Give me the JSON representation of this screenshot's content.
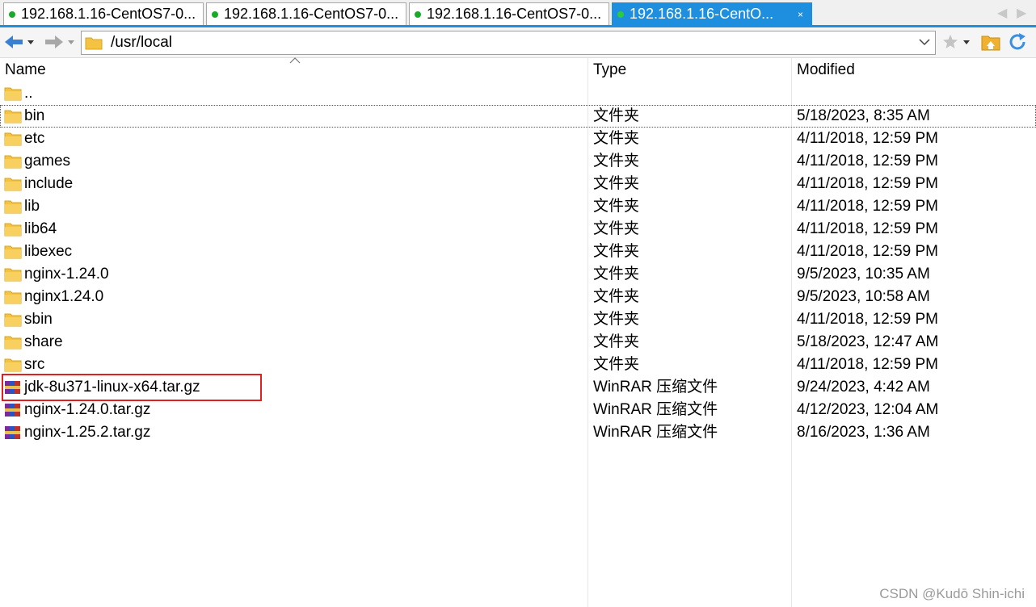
{
  "tabs": [
    {
      "label": "192.168.1.16-CentOS7-0..."
    },
    {
      "label": "192.168.1.16-CentOS7-0..."
    },
    {
      "label": "192.168.1.16-CentOS7-0..."
    },
    {
      "label": "192.168.1.16-CentO...",
      "active": true,
      "close": "×"
    }
  ],
  "toolbar": {
    "path": "/usr/local"
  },
  "columns": {
    "name": "Name",
    "type": "Type",
    "modified": "Modified"
  },
  "files": [
    {
      "name": "..",
      "type": "",
      "modified": "",
      "icon": "folder-icon"
    },
    {
      "name": "bin",
      "type": "文件夹",
      "modified": "5/18/2023, 8:35 AM",
      "icon": "folder-icon"
    },
    {
      "name": "etc",
      "type": "文件夹",
      "modified": "4/11/2018, 12:59 PM",
      "icon": "folder-icon"
    },
    {
      "name": "games",
      "type": "文件夹",
      "modified": "4/11/2018, 12:59 PM",
      "icon": "folder-icon"
    },
    {
      "name": "include",
      "type": "文件夹",
      "modified": "4/11/2018, 12:59 PM",
      "icon": "folder-icon"
    },
    {
      "name": "lib",
      "type": "文件夹",
      "modified": "4/11/2018, 12:59 PM",
      "icon": "folder-icon"
    },
    {
      "name": "lib64",
      "type": "文件夹",
      "modified": "4/11/2018, 12:59 PM",
      "icon": "folder-icon"
    },
    {
      "name": "libexec",
      "type": "文件夹",
      "modified": "4/11/2018, 12:59 PM",
      "icon": "folder-icon"
    },
    {
      "name": "nginx-1.24.0",
      "type": "文件夹",
      "modified": "9/5/2023, 10:35 AM",
      "icon": "folder-icon"
    },
    {
      "name": "nginx1.24.0",
      "type": "文件夹",
      "modified": "9/5/2023, 10:58 AM",
      "icon": "folder-icon"
    },
    {
      "name": "sbin",
      "type": "文件夹",
      "modified": "4/11/2018, 12:59 PM",
      "icon": "folder-icon"
    },
    {
      "name": "share",
      "type": "文件夹",
      "modified": "5/18/2023, 12:47 AM",
      "icon": "folder-icon"
    },
    {
      "name": "src",
      "type": "文件夹",
      "modified": "4/11/2018, 12:59 PM",
      "icon": "folder-icon"
    },
    {
      "name": "jdk-8u371-linux-x64.tar.gz",
      "type": "WinRAR 压缩文件",
      "modified": "9/24/2023, 4:42 AM",
      "icon": "winrar-archive-icon"
    },
    {
      "name": "nginx-1.24.0.tar.gz",
      "type": "WinRAR 压缩文件",
      "modified": "4/12/2023, 12:04 AM",
      "icon": "winrar-archive-icon"
    },
    {
      "name": "nginx-1.25.2.tar.gz",
      "type": "WinRAR 压缩文件",
      "modified": "8/16/2023, 1:36 AM",
      "icon": "winrar-archive-icon"
    }
  ],
  "selected_row": "bin",
  "watermark": "CSDN @Kudō Shin-ichi",
  "colors": {
    "accent": "#1e8ede",
    "highlight_box": "#e02020",
    "folder": "#f5c342",
    "status_dot": "#1aaa2a"
  }
}
